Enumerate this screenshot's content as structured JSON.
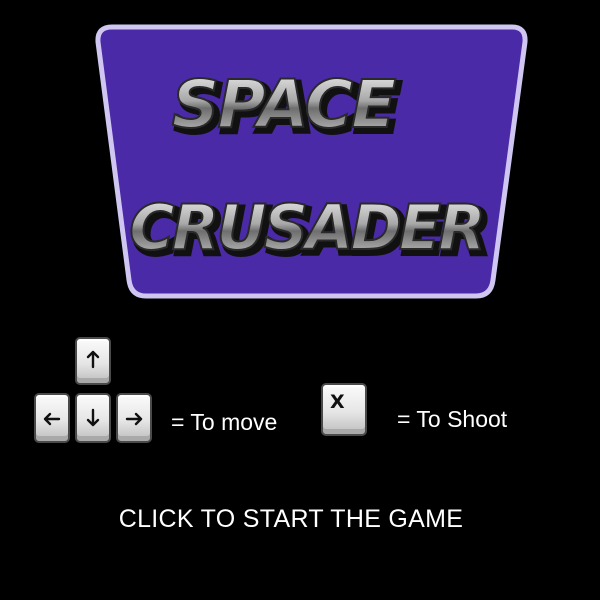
{
  "game": {
    "title_line1": "SPACE",
    "title_line2": "CRUSADER",
    "move_label": "= To move",
    "shoot_label": "= To Shoot",
    "shoot_key": "X",
    "start_prompt": "CLICK TO START THE GAME"
  },
  "icons": {
    "up": "arrow-up-key-icon",
    "left": "arrow-left-key-icon",
    "down": "arrow-down-key-icon",
    "right": "arrow-right-key-icon"
  },
  "colors": {
    "background": "#000000",
    "panel_fill": "#4a2aa6",
    "panel_border": "#cfc6f2",
    "title_face": "#b8b8b8",
    "title_shadow": "#1a1a1a",
    "text": "#ffffff"
  }
}
